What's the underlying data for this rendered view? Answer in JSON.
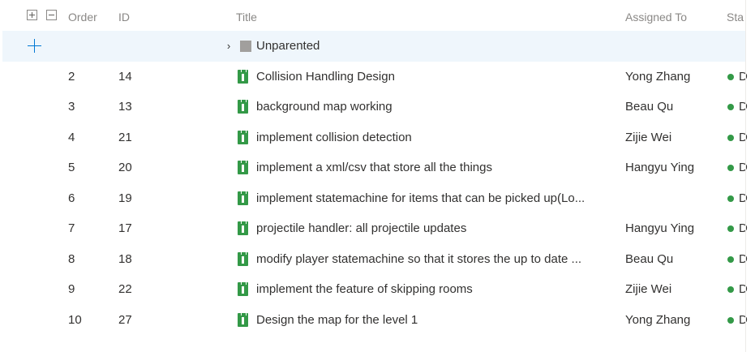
{
  "header": {
    "order": "Order",
    "id": "ID",
    "title": "Title",
    "assigned_to": "Assigned To",
    "state": "Sta"
  },
  "unparented": {
    "title": "Unparented",
    "icon": "gray-square-icon"
  },
  "rows": [
    {
      "order": "2",
      "id": "14",
      "title": "Collision Handling Design",
      "assigned": "Yong Zhang",
      "state": "D"
    },
    {
      "order": "3",
      "id": "13",
      "title": "background map working",
      "assigned": "Beau Qu",
      "state": "D"
    },
    {
      "order": "4",
      "id": "21",
      "title": "implement collision detection",
      "assigned": "Zijie Wei",
      "state": "D"
    },
    {
      "order": "5",
      "id": "20",
      "title": "implement a xml/csv that store all the things",
      "assigned": "Hangyu Ying",
      "state": "D"
    },
    {
      "order": "6",
      "id": "19",
      "title": "implement statemachine for items that can be picked up(Lo...",
      "assigned": "",
      "state": "D"
    },
    {
      "order": "7",
      "id": "17",
      "title": "projectile handler: all projectile updates",
      "assigned": "Hangyu Ying",
      "state": "D"
    },
    {
      "order": "8",
      "id": "18",
      "title": "modify player statemachine so that it stores the up to date ...",
      "assigned": "Beau Qu",
      "state": "D"
    },
    {
      "order": "9",
      "id": "22",
      "title": "implement the feature of skipping rooms",
      "assigned": "Zijie Wei",
      "state": "D"
    },
    {
      "order": "10",
      "id": "27",
      "title": "Design the map for the level 1",
      "assigned": "Yong Zhang",
      "state": "D"
    }
  ],
  "colors": {
    "state_dot": "#339947",
    "work_item_icon": "#339947",
    "selected_row": "#eff6fc"
  }
}
